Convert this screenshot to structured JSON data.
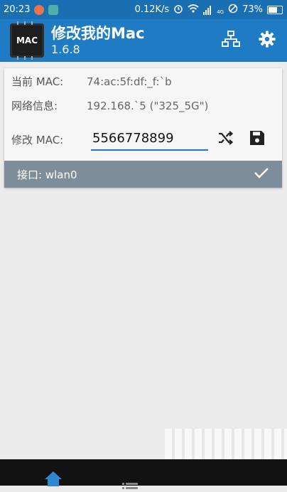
{
  "status_bar": {
    "time": "20:23",
    "speed": "0.12K/s",
    "battery": "73%",
    "battery_level": 0.73,
    "net_label": "4G",
    "icons": [
      "notification-badge-icon",
      "app-icon",
      "alarm-icon",
      "wifi-icon",
      "signal-icon",
      "do-not-disturb-icon",
      "battery-icon"
    ]
  },
  "app_bar": {
    "title": "修改我的Mac",
    "version": "1.6.8",
    "logo_text": "MAC",
    "actions": [
      "network-icon",
      "settings-icon"
    ]
  },
  "card": {
    "current_mac_label": "当前 MAC:",
    "current_mac_value": "74:ac:5f:df:_f:`b",
    "network_label": "网络信息:",
    "network_value": "192.168.`5 (\"325_5G\")",
    "modify_label": "修改 MAC:",
    "modify_value": "5566778899",
    "interface_label": "接口: wlan0"
  },
  "bottom_nav": {
    "items": [
      "home-icon",
      "list-icon"
    ]
  },
  "colors": {
    "status_bar": "#1a6fb3",
    "app_bar": "#1f7cc4",
    "interface_bar": "#7d8e9a",
    "bottom_nav": "#121212"
  }
}
